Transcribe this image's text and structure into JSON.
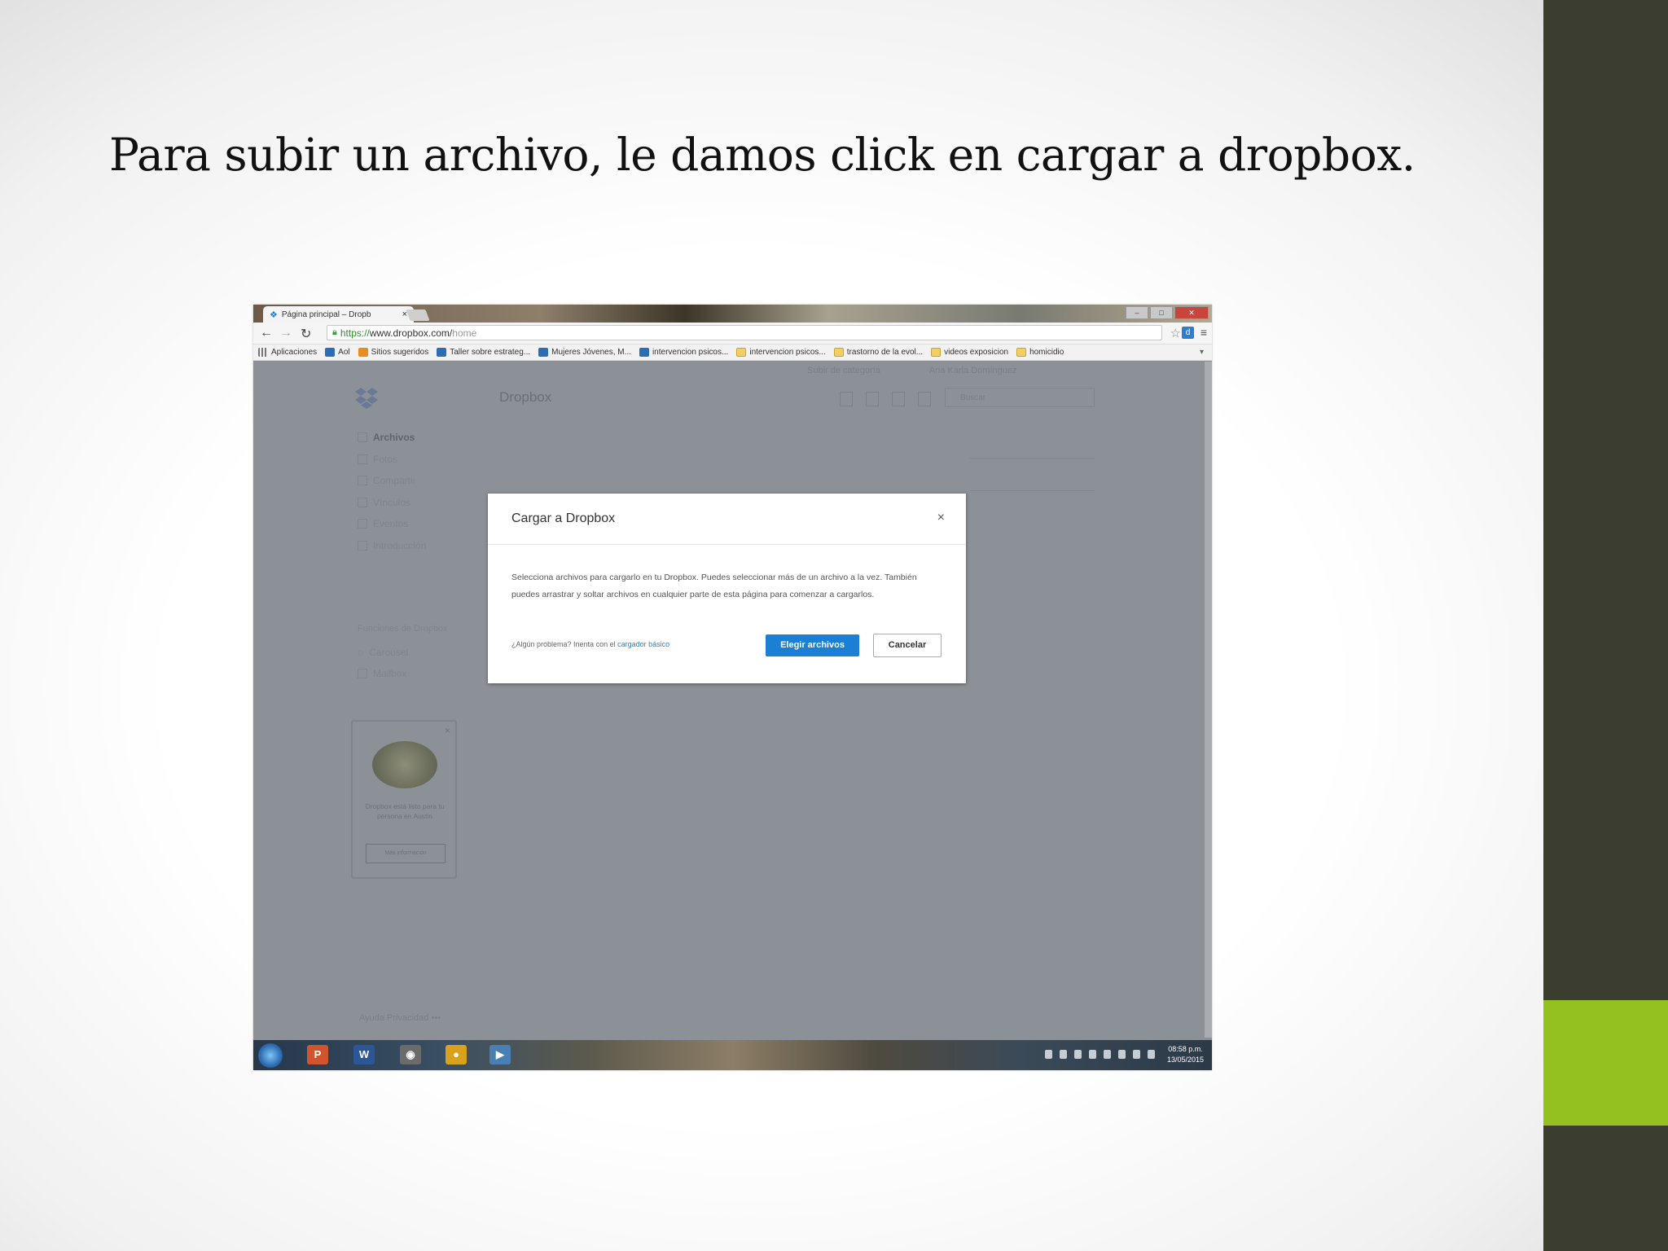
{
  "slide": {
    "title": "Para subir un archivo, le damos click en cargar a  dropbox."
  },
  "browser": {
    "tab_title": "Página principal – Dropb",
    "tab_close": "×",
    "url_https": "https://",
    "url_host": "www.dropbox.com/",
    "url_path": "home",
    "bookmarks": [
      {
        "label": "Aplicaciones",
        "icon": "grid"
      },
      {
        "label": "Aol",
        "icon": "blue"
      },
      {
        "label": "Sitios sugeridos",
        "icon": "orange"
      },
      {
        "label": "Taller sobre estrateg...",
        "icon": "blue"
      },
      {
        "label": "Mujeres Jóvenes, M...",
        "icon": "blue"
      },
      {
        "label": "intervencion psicos...",
        "icon": "blue"
      },
      {
        "label": "intervencion psicos...",
        "icon": "folder"
      },
      {
        "label": "trastorno de la evol...",
        "icon": "folder"
      },
      {
        "label": "videos exposicion",
        "icon": "folder"
      },
      {
        "label": "homicidio",
        "icon": "folder"
      }
    ]
  },
  "dropbox": {
    "breadcrumb": "Dropbox",
    "search_placeholder": "Buscar",
    "top_right": [
      "Subir de categoría",
      "Ana Karla Domínguez"
    ],
    "nav": [
      "Archivos",
      "Fotos",
      "Compartir",
      "Vínculos",
      "Eventos",
      "Introducción"
    ],
    "other_title": "Funciones de Dropbox",
    "other": [
      "Carousel",
      "Mailbox"
    ],
    "promo_text": "Dropbox está listo para tu persona en Austin",
    "promo_button": "Más información",
    "footer": "Ayuda  Privacidad  •••"
  },
  "modal": {
    "title": "Cargar a Dropbox",
    "close": "×",
    "body": "Selecciona archivos para cargarlo en tu Dropbox. Puedes seleccionar más de un archivo a la vez. También puedes arrastrar y soltar archivos en cualquier parte de esta página para comenzar a cargarlos.",
    "help_prefix": "¿Algún problema? Inenta con el",
    "help_link": "cargador básico",
    "primary": "Elegir archivos",
    "secondary": "Cancelar"
  },
  "taskbar": {
    "apps": [
      {
        "name": "powerpoint",
        "glyph": "P",
        "color": "#d2542d"
      },
      {
        "name": "word",
        "glyph": "W",
        "color": "#2b5797"
      },
      {
        "name": "explorer",
        "glyph": "◉",
        "color": "#6b6b6b"
      },
      {
        "name": "chrome",
        "glyph": "●",
        "color": "#d9a21b"
      },
      {
        "name": "media",
        "glyph": "▶",
        "color": "#4a7fb3"
      }
    ],
    "time": "08:58 p.m.",
    "date": "13/05/2015"
  },
  "colors": {
    "side_panel": "#3b3d30",
    "side_accent": "#94c11f",
    "primary_button": "#1b7fd6"
  }
}
